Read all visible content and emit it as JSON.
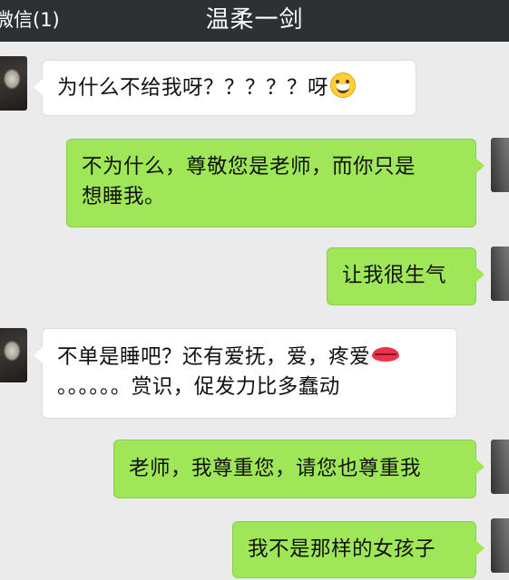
{
  "header": {
    "back_label": "微信(1)",
    "title": "温柔一剑"
  },
  "messages": [
    {
      "side": "in",
      "lines": [
        "为什么不给我呀？？？？？呀"
      ],
      "emoji": "grinning-face"
    },
    {
      "side": "out",
      "lines": [
        "不为什么，尊敬您是老师，而你只是",
        "想睡我。"
      ]
    },
    {
      "side": "out",
      "lines": [
        "让我很生气"
      ]
    },
    {
      "side": "in",
      "lines": [
        "不单是睡吧？还有爱抚，爱，疼爱",
        "。。。。。。赏识，促发力比多蠢动"
      ],
      "emoji": "lips"
    },
    {
      "side": "out",
      "lines": [
        "老师，我尊重您，请您也尊重我"
      ]
    },
    {
      "side": "out",
      "lines": [
        "我不是那样的女孩子"
      ]
    }
  ],
  "colors": {
    "header_bg": "#2e3133",
    "chat_bg": "#ebebeb",
    "outgoing_bubble": "#9fe658",
    "incoming_bubble": "#ffffff"
  }
}
